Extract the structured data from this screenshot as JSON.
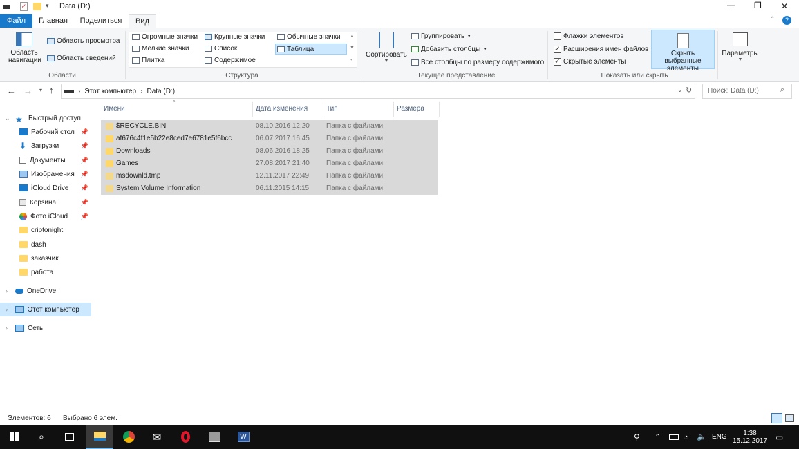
{
  "window": {
    "title": "Data (D:)",
    "controls": {
      "minimize": "—",
      "maximize": "❐",
      "close": "✕"
    }
  },
  "ribbon_tabs": [
    {
      "label": "Файл"
    },
    {
      "label": "Главная"
    },
    {
      "label": "Поделиться"
    },
    {
      "label": "Вид"
    }
  ],
  "ribbon": {
    "groups": {
      "areas": "Области",
      "structure": "Структура",
      "current_view": "Текущее представление",
      "show_hide": "Показать или скрыть"
    },
    "nav_pane": "Область навигации",
    "preview_pane": "Область просмотра",
    "details_pane": "Область сведений",
    "layouts": [
      {
        "label": "Огромные значки",
        "icon": "huge-icons-icon"
      },
      {
        "label": "Крупные значки",
        "icon": "large-icons-icon"
      },
      {
        "label": "Обычные значки",
        "icon": "medium-icons-icon"
      },
      {
        "label": "Мелкие значки",
        "icon": "small-icons-icon"
      },
      {
        "label": "Список",
        "icon": "list-icon"
      },
      {
        "label": "Таблица",
        "icon": "details-icon",
        "selected": true
      },
      {
        "label": "Плитка",
        "icon": "tiles-icon"
      },
      {
        "label": "Содержимое",
        "icon": "content-icon"
      }
    ],
    "sort": "Сортировать",
    "group_by": "Группировать",
    "add_columns": "Добавить столбцы",
    "size_all_columns": "Все столбцы по размеру содержимого",
    "item_checkboxes": {
      "label": "Флажки элементов",
      "checked": false
    },
    "file_extensions": {
      "label": "Расширения имен файлов",
      "checked": true
    },
    "hidden_items": {
      "label": "Скрытые элементы",
      "checked": true
    },
    "hide_selected": "Скрыть выбранные элементы",
    "options": "Параметры"
  },
  "address": {
    "path": [
      "Этот компьютер",
      "Data (D:)"
    ],
    "search_placeholder": "Поиск: Data (D:)"
  },
  "nav": {
    "quick_access": "Быстрый доступ",
    "items": [
      {
        "label": "Рабочий стол",
        "pinned": true
      },
      {
        "label": "Загрузки",
        "pinned": true
      },
      {
        "label": "Документы",
        "pinned": true
      },
      {
        "label": "Изображения",
        "pinned": true
      },
      {
        "label": "iCloud Drive",
        "pinned": true
      },
      {
        "label": "Корзина",
        "pinned": true
      },
      {
        "label": "Фото iCloud",
        "pinned": true
      },
      {
        "label": "criptonight",
        "pinned": false
      },
      {
        "label": "dash",
        "pinned": false
      },
      {
        "label": "заказчик",
        "pinned": false
      },
      {
        "label": "работа",
        "pinned": false
      }
    ],
    "onedrive": "OneDrive",
    "this_pc": "Этот компьютер",
    "network": "Сеть"
  },
  "columns": {
    "name": "Имени",
    "date": "Дата изменения",
    "type": "Тип",
    "size": "Размера"
  },
  "files": [
    {
      "name": "$RECYCLE.BIN",
      "date": "08.10.2016 12:20",
      "type": "Папка с файлами"
    },
    {
      "name": "af676c4f1e5b22e8ced7e6781e5f6bcc",
      "date": "06.07.2017 16:45",
      "type": "Папка с файлами"
    },
    {
      "name": "Downloads",
      "date": "08.06.2016 18:25",
      "type": "Папка с файлами"
    },
    {
      "name": "Games",
      "date": "27.08.2017 21:40",
      "type": "Папка с файлами"
    },
    {
      "name": "msdownld.tmp",
      "date": "12.11.2017 22:49",
      "type": "Папка с файлами"
    },
    {
      "name": "System Volume Information",
      "date": "06.11.2015 14:15",
      "type": "Папка с файлами"
    }
  ],
  "status": {
    "count": "Элементов: 6",
    "selected": "Выбрано 6 элем."
  },
  "taskbar": {
    "lang": "ENG",
    "time": "1:38",
    "date": "15.12.2017"
  },
  "colors": {
    "accent": "#1979ca",
    "selection": "#d9d9d9",
    "nav_selected": "#cce8ff",
    "taskbar": "#101010"
  }
}
